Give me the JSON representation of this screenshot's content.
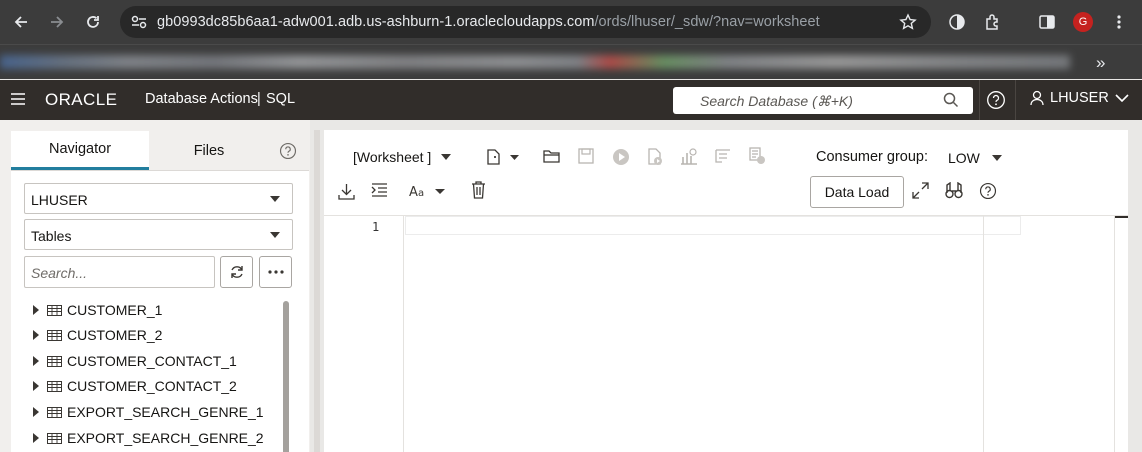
{
  "browser": {
    "url_host": "gb0993dc85b6aa1-adw001.adb.us-ashburn-1.oraclecloudapps.com",
    "url_path": "/ords/lhuser/_sdw/?nav=worksheet",
    "profile_initial": "G"
  },
  "header": {
    "logo": "ORACLE",
    "app_name": "Database Actions",
    "separator": "|",
    "section": "SQL",
    "search_placeholder": "Search Database (⌘+K)",
    "user": "LHUSER"
  },
  "navigator": {
    "tabs": [
      "Navigator",
      "Files"
    ],
    "schema": "LHUSER",
    "object_type": "Tables",
    "search_placeholder": "Search...",
    "items": [
      "CUSTOMER_1",
      "CUSTOMER_2",
      "CUSTOMER_CONTACT_1",
      "CUSTOMER_CONTACT_2",
      "EXPORT_SEARCH_GENRE_1",
      "EXPORT_SEARCH_GENRE_2"
    ]
  },
  "worksheet": {
    "selector": "[Worksheet ]",
    "consumer_group_label": "Consumer group:",
    "consumer_group_value": "LOW",
    "data_load_label": "Data Load",
    "line_numbers": [
      "1"
    ]
  }
}
